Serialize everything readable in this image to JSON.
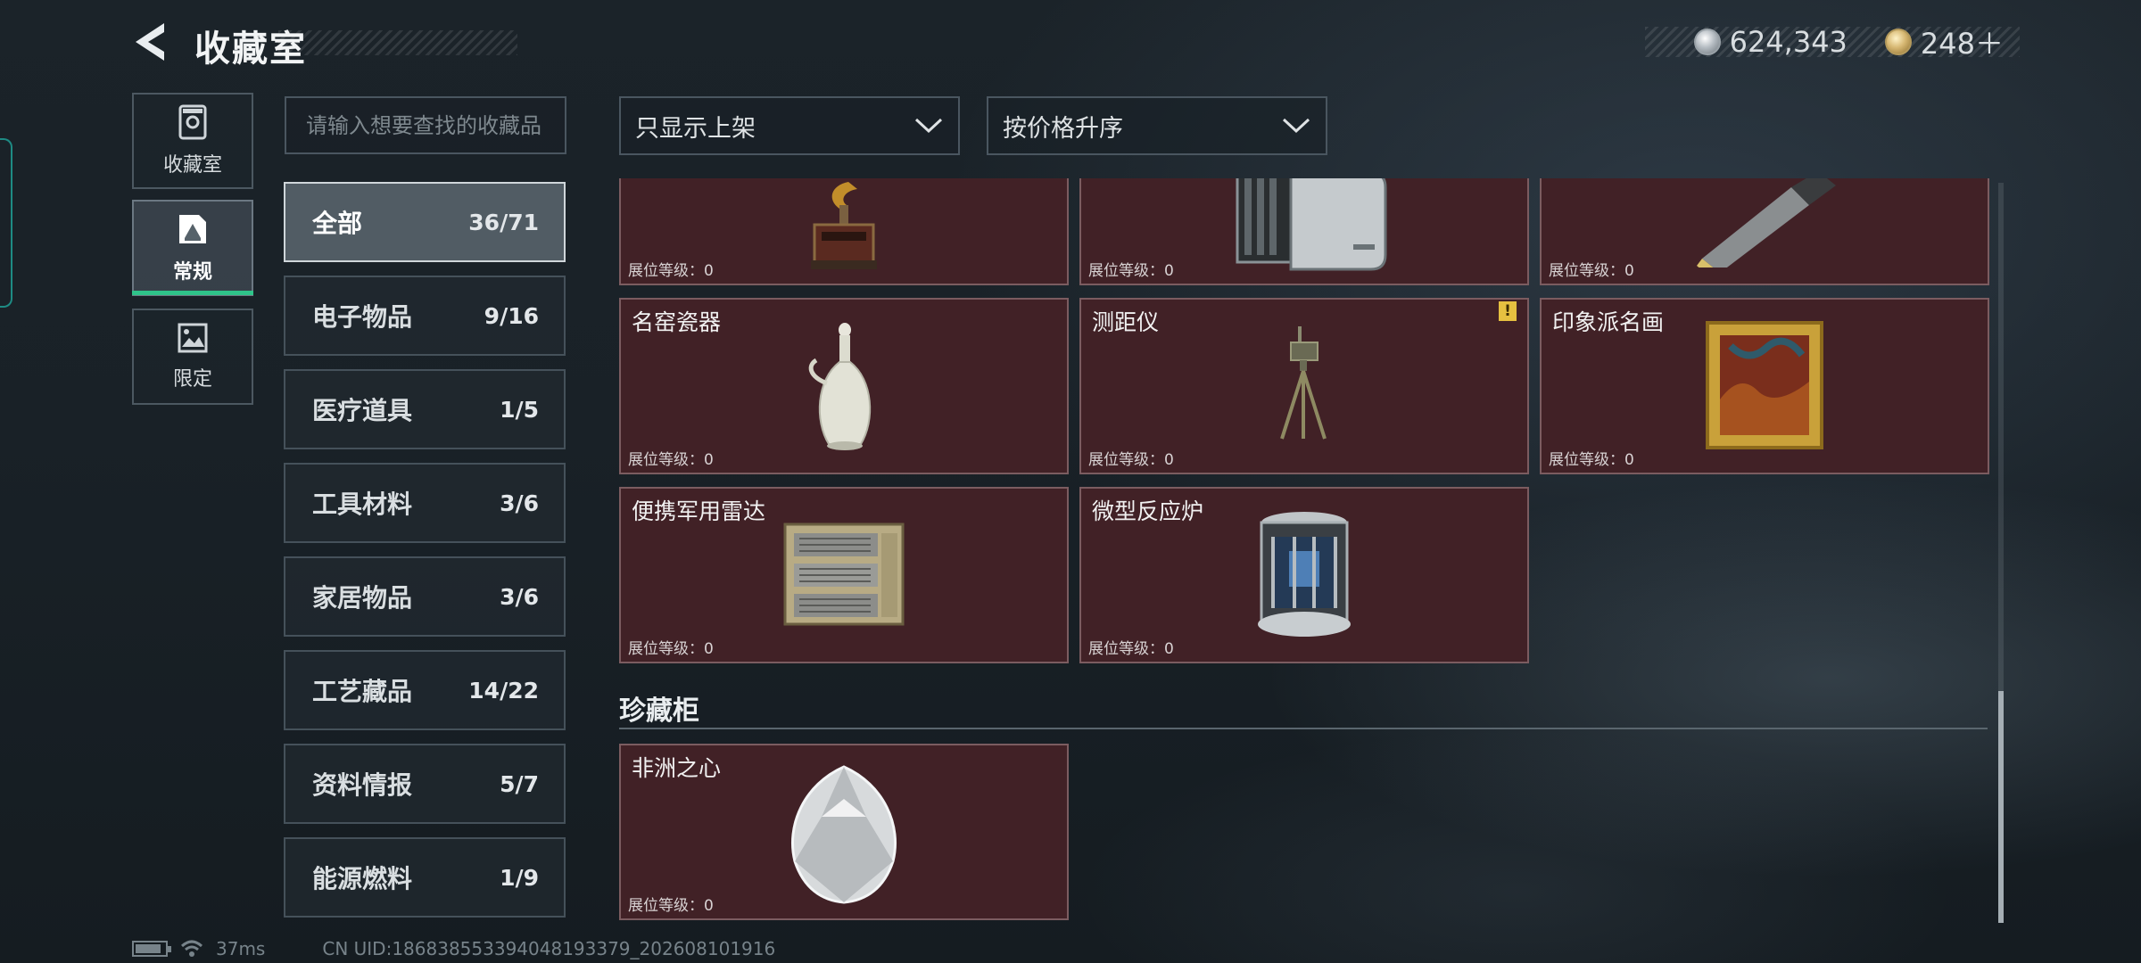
{
  "header": {
    "title": "收藏室",
    "silver_amount": "624,343",
    "gold_amount": "248＋"
  },
  "rail": [
    {
      "label": "收藏室",
      "icon": "vault-icon",
      "active": false
    },
    {
      "label": "常规",
      "icon": "picture-icon",
      "active": true
    },
    {
      "label": "限定",
      "icon": "limited-picture-icon",
      "active": false
    }
  ],
  "search": {
    "placeholder": "请输入想要查找的收藏品"
  },
  "filters": {
    "shelf_filter": "只显示上架",
    "sort_order": "按价格升序"
  },
  "categories": [
    {
      "name": "全部",
      "count": "36/71",
      "active": true
    },
    {
      "name": "电子物品",
      "count": "9/16"
    },
    {
      "name": "医疗道具",
      "count": "1/5"
    },
    {
      "name": "工具材料",
      "count": "3/6"
    },
    {
      "name": "家居物品",
      "count": "3/6"
    },
    {
      "name": "工艺藏品",
      "count": "14/22"
    },
    {
      "name": "资料情报",
      "count": "5/7"
    },
    {
      "name": "能源燃料",
      "count": "1/9"
    }
  ],
  "items": [
    {
      "name": "",
      "level_label": "展位等级：0",
      "icon": "gramophone-icon"
    },
    {
      "name": "",
      "level_label": "展位等级：0",
      "icon": "server-device-icon"
    },
    {
      "name": "",
      "level_label": "展位等级：0",
      "icon": "shell-cartridge-icon"
    },
    {
      "name": "名窑瓷器",
      "level_label": "展位等级：0",
      "icon": "porcelain-vase-icon"
    },
    {
      "name": "测距仪",
      "level_label": "展位等级：0",
      "icon": "rangefinder-tripod-icon",
      "warning": "!"
    },
    {
      "name": "印象派名画",
      "level_label": "展位等级：0",
      "icon": "framed-painting-icon"
    },
    {
      "name": "便携军用雷达",
      "level_label": "展位等级：0",
      "icon": "military-radar-icon"
    },
    {
      "name": "微型反应炉",
      "level_label": "展位等级：0",
      "icon": "mini-reactor-icon"
    }
  ],
  "showcase": {
    "title": "珍藏柜",
    "items": [
      {
        "name": "非洲之心",
        "level_label": "展位等级：0",
        "icon": "diamond-icon"
      }
    ]
  },
  "status": {
    "ping": "37ms",
    "uid": "CN UID:18683855339404819337​9_202608101916"
  },
  "colors": {
    "card_bg": "#412126",
    "active_tab_underline": "#2fc48a",
    "warning": "#e6c040"
  }
}
